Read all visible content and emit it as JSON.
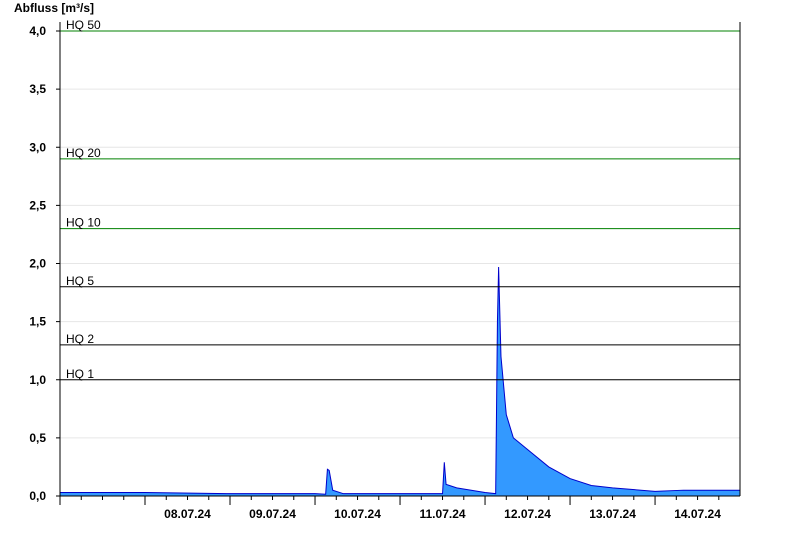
{
  "chart_data": {
    "type": "area",
    "ylabel": "Abfluss [m³/s]",
    "ylim": [
      0,
      4.0
    ],
    "xlim": [
      "07.07.24 00:00",
      "14.07.24 23:59"
    ],
    "grid": true,
    "y_ticks": [
      "0,0",
      "0,5",
      "1,0",
      "1,5",
      "2,0",
      "2,5",
      "3,0",
      "3,5",
      "4,0"
    ],
    "x_ticks": [
      "08.07.24",
      "09.07.24",
      "10.07.24",
      "11.07.24",
      "12.07.24",
      "13.07.24",
      "14.07.24"
    ],
    "reference_lines": [
      {
        "label": "HQ 1",
        "value": 1.0,
        "color": "#000000"
      },
      {
        "label": "HQ 2",
        "value": 1.3,
        "color": "#000000"
      },
      {
        "label": "HQ 5",
        "value": 1.8,
        "color": "#000000"
      },
      {
        "label": "HQ 10",
        "value": 2.3,
        "color": "#008000"
      },
      {
        "label": "HQ 20",
        "value": 2.9,
        "color": "#008000"
      },
      {
        "label": "HQ 50",
        "value": 4.0,
        "color": "#008000"
      }
    ],
    "series": [
      {
        "fill": "#3399ff",
        "stroke": "#0000cc",
        "points": [
          {
            "t": "07.07.24 00:00",
            "v": 0.03
          },
          {
            "t": "08.07.24 00:00",
            "v": 0.03
          },
          {
            "t": "08.07.24 00:00",
            "v": 0.03
          },
          {
            "t": "08.07.24 23:00",
            "v": 0.02
          },
          {
            "t": "10.07.24 00:00",
            "v": 0.02
          },
          {
            "t": "10.07.24 03:00",
            "v": 0.015
          },
          {
            "t": "10.07.24 03:30",
            "v": 0.23
          },
          {
            "t": "10.07.24 04:00",
            "v": 0.22
          },
          {
            "t": "10.07.24 05:00",
            "v": 0.05
          },
          {
            "t": "10.07.24 08:00",
            "v": 0.02
          },
          {
            "t": "11.07.24 12:00",
            "v": 0.02
          },
          {
            "t": "11.07.24 12:30",
            "v": 0.29
          },
          {
            "t": "11.07.24 13:00",
            "v": 0.1
          },
          {
            "t": "11.07.24 16:00",
            "v": 0.07
          },
          {
            "t": "12.07.24 00:00",
            "v": 0.03
          },
          {
            "t": "12.07.24 03:00",
            "v": 0.02
          },
          {
            "t": "12.07.24 03:30",
            "v": 1.5
          },
          {
            "t": "12.07.24 03:50",
            "v": 1.97
          },
          {
            "t": "12.07.24 04:30",
            "v": 1.2
          },
          {
            "t": "12.07.24 06:00",
            "v": 0.7
          },
          {
            "t": "12.07.24 08:00",
            "v": 0.5
          },
          {
            "t": "12.07.24 12:00",
            "v": 0.4
          },
          {
            "t": "12.07.24 18:00",
            "v": 0.25
          },
          {
            "t": "13.07.24 00:00",
            "v": 0.15
          },
          {
            "t": "13.07.24 06:00",
            "v": 0.09
          },
          {
            "t": "13.07.24 12:00",
            "v": 0.07
          },
          {
            "t": "14.07.24 00:00",
            "v": 0.04
          },
          {
            "t": "14.07.24 08:00",
            "v": 0.05
          },
          {
            "t": "14.07.24 23:59",
            "v": 0.05
          }
        ]
      }
    ]
  }
}
